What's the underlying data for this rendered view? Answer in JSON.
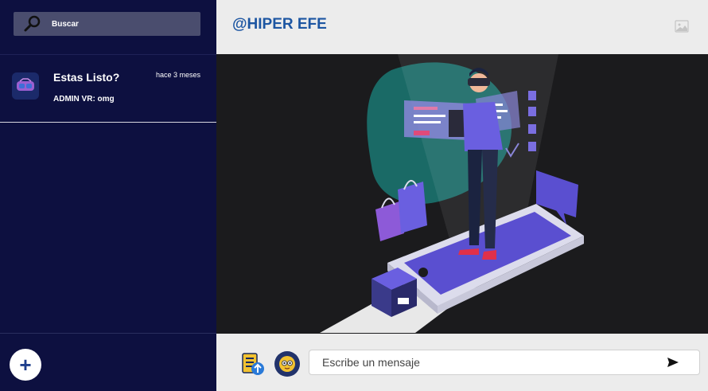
{
  "sidebar": {
    "search": {
      "label": "Buscar"
    },
    "chats": [
      {
        "title": "Estas Listo?",
        "time": "hace 3 meses",
        "preview": "ADMIN VR: omg"
      }
    ],
    "add_button": {
      "label": "+"
    }
  },
  "header": {
    "channel": "@HIPER EFE"
  },
  "composer": {
    "placeholder": "Escribe un mensaje"
  },
  "colors": {
    "sidebar_bg": "#0d1040",
    "accent_blue": "#1d56a2",
    "header_bg": "#ececec",
    "hero_bg": "#1b1b1d"
  },
  "icons": [
    "search-icon",
    "vr-headset-icon",
    "add-icon",
    "image-icon",
    "attach-icon",
    "emoji-icon",
    "send-icon"
  ]
}
